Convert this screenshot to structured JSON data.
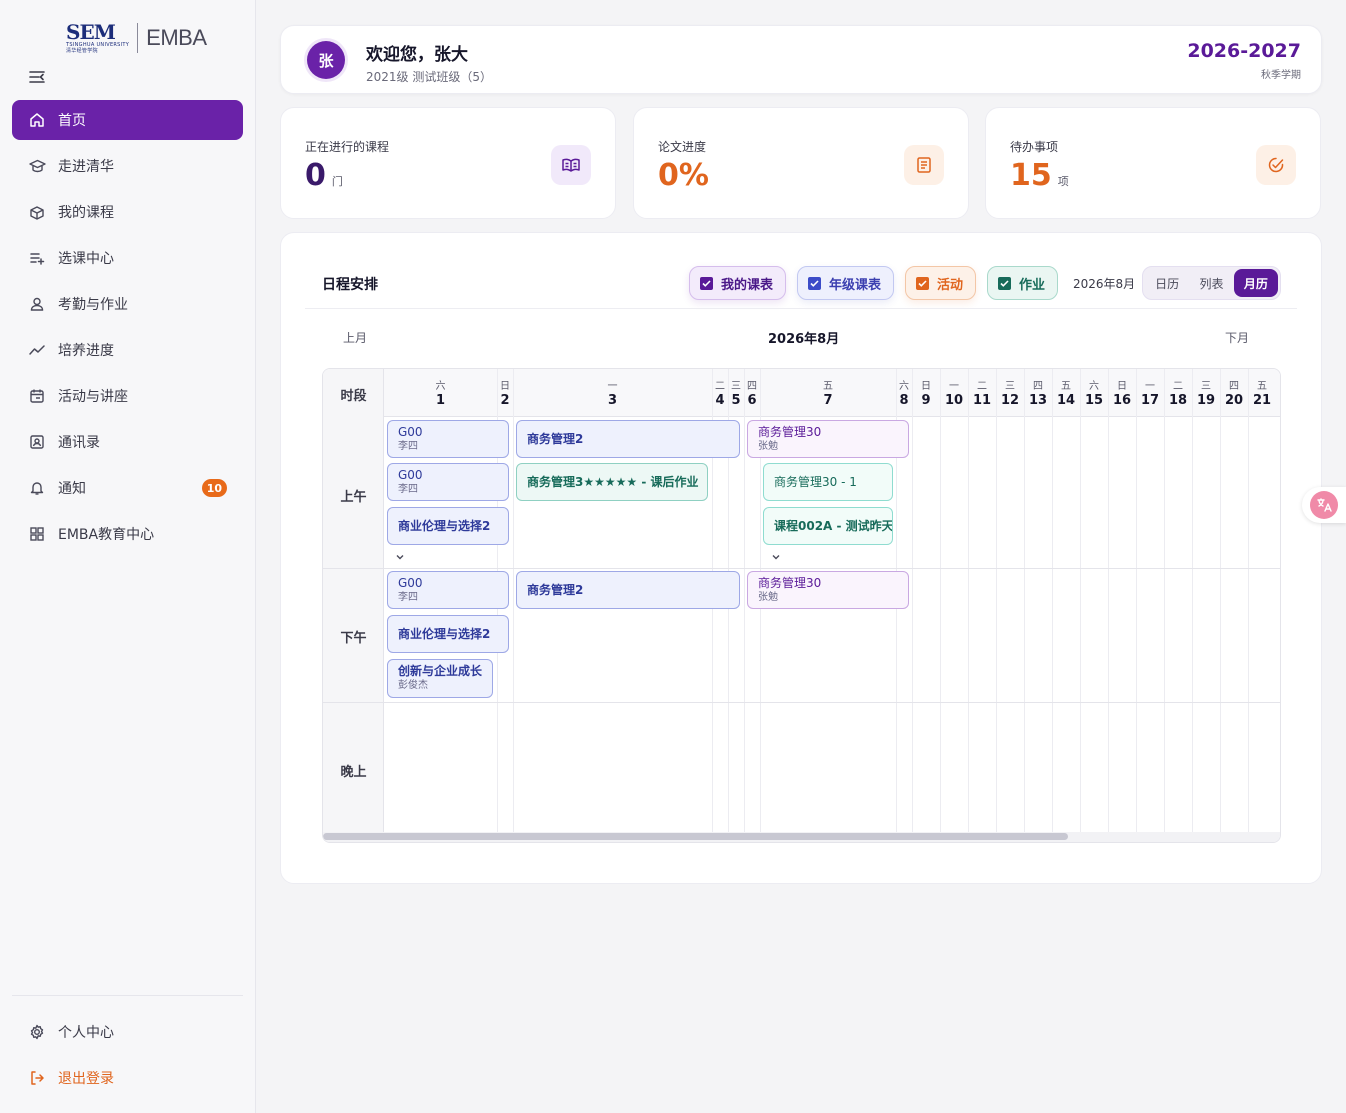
{
  "brand": {
    "sem": "SEM",
    "sub": "TSINGHUA UNIVERSITY",
    "sub2": "清华经管学院",
    "product": "EMBA"
  },
  "nav": {
    "items": [
      {
        "label": "首页",
        "icon": "home-icon",
        "active": true
      },
      {
        "label": "走进清华",
        "icon": "graduation-cap-icon"
      },
      {
        "label": "我的课程",
        "icon": "course-box-icon"
      },
      {
        "label": "选课中心",
        "icon": "list-add-icon"
      },
      {
        "label": "考勤与作业",
        "icon": "user-icon"
      },
      {
        "label": "培养进度",
        "icon": "trend-icon"
      },
      {
        "label": "活动与讲座",
        "icon": "calendar-icon"
      },
      {
        "label": "通讯录",
        "icon": "contact-card-icon"
      },
      {
        "label": "通知",
        "icon": "bell-icon",
        "badge": "10"
      },
      {
        "label": "EMBA教育中心",
        "icon": "grid-icon"
      }
    ],
    "bottom": [
      {
        "label": "个人中心",
        "icon": "gear-icon"
      },
      {
        "label": "退出登录",
        "icon": "logout-icon"
      }
    ]
  },
  "header": {
    "avatar": "张",
    "welcome": "欢迎您，张大",
    "subline": "2021级 测试班级（5）",
    "year": "2026-2027",
    "term": "秋季学期"
  },
  "stats": [
    {
      "label": "正在进行的课程",
      "value": "0",
      "unit": "门",
      "icon": "book-open-icon",
      "color": "#5a1a98"
    },
    {
      "label": "论文进度",
      "value": "0%",
      "unit": "",
      "icon": "document-icon",
      "color": "#e0651e"
    },
    {
      "label": "待办事项",
      "value": "15",
      "unit": "项",
      "icon": "check-circle-icon",
      "color": "#e0651e"
    }
  ],
  "schedule": {
    "title": "日程安排",
    "filters": [
      {
        "label": "我的课表",
        "checked": true
      },
      {
        "label": "年级课表",
        "checked": true
      },
      {
        "label": "活动",
        "checked": true
      },
      {
        "label": "作业",
        "checked": true
      }
    ],
    "month_label": "2026年8月",
    "views": [
      "日历",
      "列表",
      "月历"
    ],
    "active_view": "月历",
    "prev": "上月",
    "next": "下月",
    "calendar_month": "2026年8月",
    "slot_header": "时段",
    "slots": [
      "上午",
      "下午",
      "晚上"
    ],
    "days": [
      {
        "wd": "六",
        "dn": "1"
      },
      {
        "wd": "日",
        "dn": "2"
      },
      {
        "wd": "一",
        "dn": "3"
      },
      {
        "wd": "二",
        "dn": "4"
      },
      {
        "wd": "三",
        "dn": "5"
      },
      {
        "wd": "四",
        "dn": "6"
      },
      {
        "wd": "五",
        "dn": "7"
      },
      {
        "wd": "六",
        "dn": "8"
      },
      {
        "wd": "日",
        "dn": "9"
      },
      {
        "wd": "一",
        "dn": "10"
      },
      {
        "wd": "二",
        "dn": "11"
      },
      {
        "wd": "三",
        "dn": "12"
      },
      {
        "wd": "四",
        "dn": "13"
      },
      {
        "wd": "五",
        "dn": "14"
      },
      {
        "wd": "六",
        "dn": "15"
      },
      {
        "wd": "日",
        "dn": "16"
      },
      {
        "wd": "一",
        "dn": "17"
      },
      {
        "wd": "二",
        "dn": "18"
      },
      {
        "wd": "三",
        "dn": "19"
      },
      {
        "wd": "四",
        "dn": "20"
      },
      {
        "wd": "五",
        "dn": "21"
      }
    ],
    "events": {
      "am_d1_1": {
        "title": "G00",
        "sub": "李四"
      },
      "am_d1_2": {
        "title": "G00",
        "sub": "李四"
      },
      "am_d1_3": {
        "title": "商业伦理与选择2"
      },
      "am_d3_1": {
        "title": "商务管理2"
      },
      "am_d3_2": {
        "title": "商务管理3★★★★★ - 课后作业"
      },
      "am_d7_1": {
        "title": "商务管理30",
        "sub": "张勉"
      },
      "am_d7_2": {
        "title": "商务管理30 - 1"
      },
      "am_d7_3": {
        "title": "课程002A - 测试昨天"
      },
      "pm_d1_1": {
        "title": "G00",
        "sub": "李四"
      },
      "pm_d1_2": {
        "title": "商业伦理与选择2"
      },
      "pm_d1_3": {
        "title": "创新与企业成长",
        "sub": "彭俊杰"
      },
      "pm_d3_1": {
        "title": "商务管理2"
      },
      "pm_d7_1": {
        "title": "商务管理30",
        "sub": "张勉"
      }
    }
  },
  "colors": {
    "primary": "#6a22a8",
    "accent": "#e0651e",
    "teal": "#176b5a"
  }
}
